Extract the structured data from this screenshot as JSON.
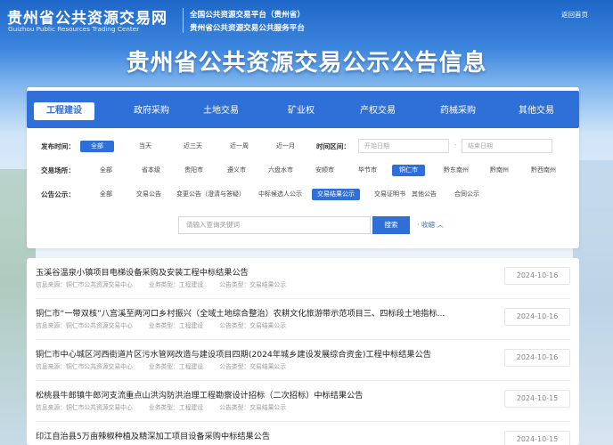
{
  "header": {
    "logo_cn": "贵州省公共资源交易网",
    "logo_en": "Guizhou Public Resources Trading Center",
    "platform_line1": "全国公共资源交易平台（贵州省）",
    "platform_line2": "贵州省公共资源交易公共服务平台",
    "home_link": "返回首页"
  },
  "banner": {
    "title": "贵州省公共资源交易公示公告信息"
  },
  "tabs": [
    "工程建设",
    "政府采购",
    "土地交易",
    "矿业权",
    "产权交易",
    "药械采购",
    "其他交易"
  ],
  "filters": {
    "time": {
      "label": "发布时间：",
      "options": [
        "全部",
        "当天",
        "近三天",
        "近一周",
        "近一月"
      ],
      "range_label": "时间区间：",
      "start_placeholder": "开始日期",
      "dash": "-",
      "end_placeholder": "结束日期"
    },
    "place": {
      "label": "交易场所：",
      "options": [
        "全部",
        "省本级",
        "贵阳市",
        "遵义市",
        "六盘水市",
        "安顺市",
        "毕节市",
        "铜仁市",
        "黔东南州",
        "黔南州",
        "黔西南州"
      ]
    },
    "notice": {
      "label": "公告公示：",
      "options": [
        "全部",
        "交易公告",
        "变更公告（澄清与答疑）",
        "中标候选人公示",
        "交易结果公示",
        "交易证明书",
        "其他公告",
        "合同公示"
      ]
    },
    "search_placeholder": "请输入查询关键词",
    "search_button": "搜索",
    "collapse_label": "· 收缩 ︿"
  },
  "results": [
    {
      "title": "玉溪谷温泉小镇项目电梯设备采购及安装工程中标结果公告",
      "source": "信息来源：铜仁市公共资源交易中心",
      "biz": "业务类型：工程建设",
      "ntype": "公告类型：交易结果公示",
      "date": "2024-10-16"
    },
    {
      "title": "铜仁市“一带双核”八宫溪至两河口乡村振兴（全域土地综合整治）农耕文化旅游带示范项目三、四标段土地指标...",
      "source": "信息来源：铜仁市公共资源交易中心",
      "biz": "业务类型：工程建设",
      "ntype": "公告类型：交易结果公示",
      "date": "2024-10-16"
    },
    {
      "title": "铜仁市中心城区河西街道片区污水管网改造与建设项目四期(2024年城乡建设发展综合资金)工程中标结果公告",
      "source": "信息来源：铜仁市公共资源交易中心",
      "biz": "业务类型：工程建设",
      "ntype": "公告类型：交易结果公示",
      "date": "2024-10-16"
    },
    {
      "title": "松桃县牛郎镇牛郎河支流重点山洪沟防洪治理工程勘察设计招标（二次招标）中标结果公告",
      "source": "信息来源：铜仁市公共资源交易中心",
      "biz": "业务类型：工程建设",
      "ntype": "公告类型：交易结果公示",
      "date": "2024-10-15"
    },
    {
      "title": "印江自治县5万亩辣椒种植及精深加工项目设备采购中标结果公告",
      "source": "",
      "biz": "",
      "ntype": "",
      "date": "2024-10-15"
    }
  ],
  "colors": {
    "primary": "#2f6fd8",
    "header_bg": "#1f67c8"
  }
}
